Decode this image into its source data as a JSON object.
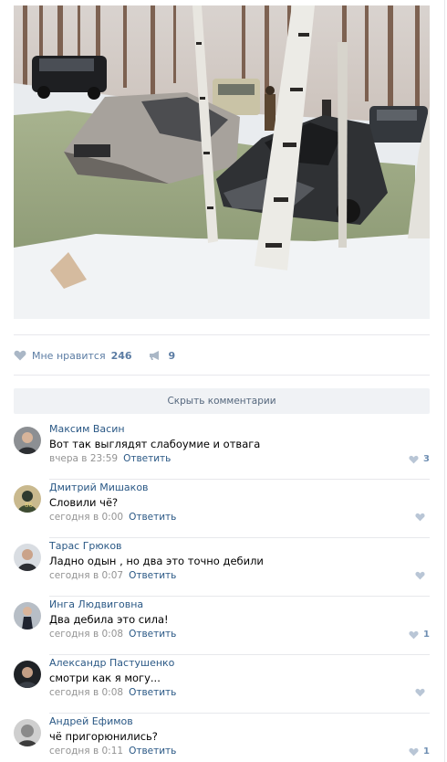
{
  "post": {
    "like_label": "Мне нравится",
    "like_count": "246",
    "share_count": "9",
    "hide_comments": "Скрыть комментарии"
  },
  "comments": [
    {
      "author": "Максим Васин",
      "text": "Вот так выглядят слабоумие и отвага",
      "date": "вчера в 23:59",
      "reply": "Ответить",
      "likes": "3"
    },
    {
      "author": "Дмитрий Мишаков",
      "text": "Словили чё?",
      "date": "сегодня в 0:00",
      "reply": "Ответить",
      "likes": ""
    },
    {
      "author": "Тарас Грюков",
      "text": "Ладно одын , но два это точно дебили",
      "date": "сегодня в 0:07",
      "reply": "Ответить",
      "likes": ""
    },
    {
      "author": "Инга Людвиговна",
      "text": "Два дебила это сила!",
      "date": "сегодня в 0:08",
      "reply": "Ответить",
      "likes": "1"
    },
    {
      "author": "Александр Пастушенко",
      "text": "смотри как я могу...",
      "date": "сегодня в 0:08",
      "reply": "Ответить",
      "likes": ""
    },
    {
      "author": "Андрей Ефимов",
      "text": "чё пригорюнились?",
      "date": "сегодня в 0:11",
      "reply": "Ответить",
      "likes": "1"
    }
  ],
  "colors": {
    "link": "#2a5885",
    "meta": "#939393",
    "accent": "#5b7ca3"
  }
}
